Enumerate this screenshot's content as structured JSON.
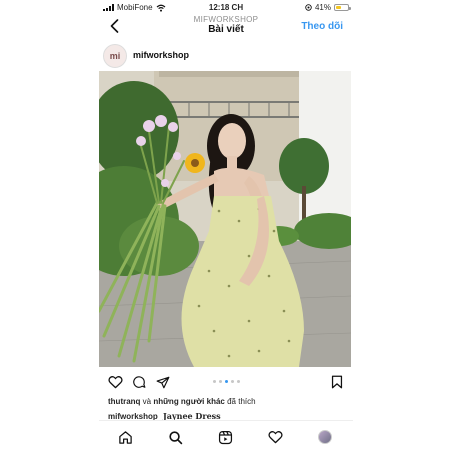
{
  "status_bar": {
    "carrier": "MobiFone",
    "time": "12:18 CH",
    "battery_percent": "41%",
    "battery_level": 0.41
  },
  "header": {
    "account": "MIFWORKSHOP",
    "title": "Bài viết",
    "follow_label": "Theo dõi"
  },
  "post": {
    "avatar_initials": "mi",
    "username": "mifworkshop",
    "carousel": {
      "total": 5,
      "active": 3
    },
    "likes": {
      "user": "thutranq",
      "connector": "và",
      "others": "những người khác",
      "suffix": "đã thích"
    },
    "caption": {
      "username": "mifworkshop",
      "text": "Jaynee Dress"
    }
  },
  "icons": {
    "back": "chevron-left-icon",
    "like": "heart-icon",
    "comment": "comment-icon",
    "share": "send-icon",
    "save": "bookmark-icon",
    "home": "home-icon",
    "search": "search-icon",
    "reels": "reels-icon",
    "activity": "heart-icon",
    "profile": "profile-avatar"
  },
  "colors": {
    "accent": "#3897f0",
    "text": "#262626",
    "battery": "#f3c623"
  }
}
